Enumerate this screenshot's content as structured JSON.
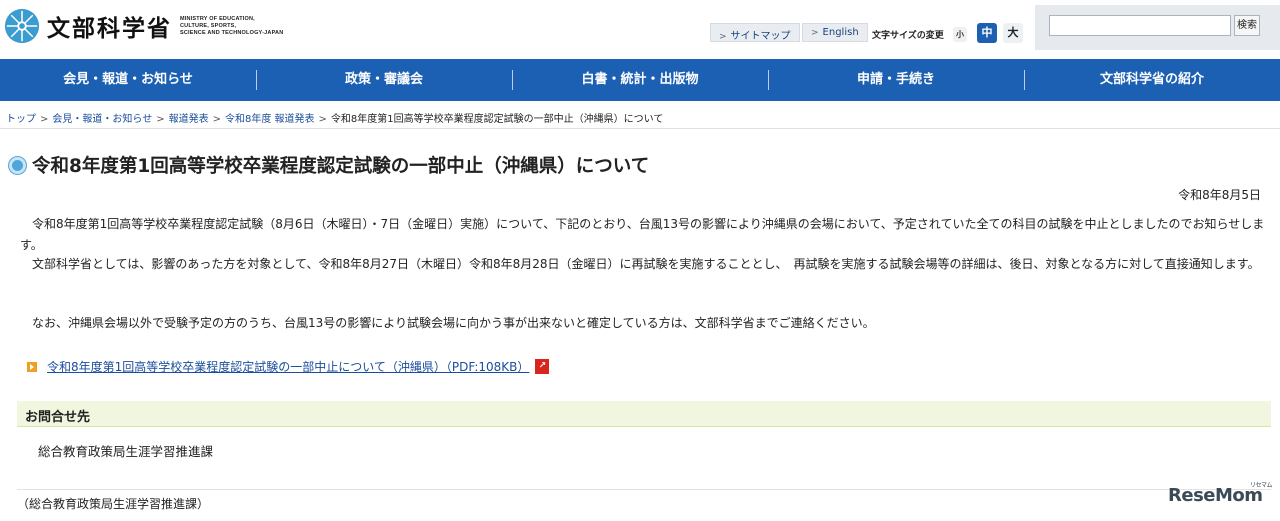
{
  "header": {
    "logo_text_jp": "文部科学省",
    "logo_text_en": [
      "MINISTRY OF EDUCATION,",
      "CULTURE, SPORTS,",
      "SCIENCE AND TECHNOLOGY-JAPAN"
    ],
    "sitemap_label": "サイトマップ",
    "english_label": "English",
    "font_size_label": "文字サイズの変更",
    "font_sizes": [
      "小",
      "中",
      "大"
    ],
    "search_placeholder": "",
    "search_button": "検索"
  },
  "gnav": {
    "items": [
      "会見・報道・お知らせ",
      "政策・審議会",
      "白書・統計・出版物",
      "申請・手続き",
      "文部科学省の紹介"
    ]
  },
  "breadcrumb": {
    "items": [
      "トップ",
      "会見・報道・お知らせ",
      "報道発表",
      "令和8年度 報道発表"
    ],
    "separator": ">",
    "current": "令和8年度第1回高等学校卒業程度認定試験の一部中止（沖縄県）について"
  },
  "main": {
    "title": "令和8年度第1回高等学校卒業程度認定試験の一部中止（沖縄県）について",
    "date": "令和8年8月5日",
    "paragraph1": "　令和8年度第1回高等学校卒業程度認定試験（8月6日（木曜日）・7日（金曜日）実施）について、下記のとおり、台風13号の影響により沖縄県の会場において、予定されていた全ての科目の試験を中止としましたのでお知らせします。",
    "paragraph2": "　文部科学省としては、影響のあった方を対象として、令和8年8月27日（木曜日）令和8年8月28日（金曜日）に再試験を実施することとし、　再試験を実施する試験会場等の詳細は、後日、対象となる方に対して直接通知します。",
    "paragraph3": "　なお、沖縄県会場以外で受験予定の方のうち、台風13号の影響により試験会場に向かう事が出来ないと確定している方は、文部科学省までご連絡ください。",
    "pdf_link": "令和8年度第1回高等学校卒業程度認定試験の一部中止について（沖縄県）（PDF:108KB）",
    "contact_heading": "お問合せ先",
    "contact_body": "総合教育政策局生涯学習推進課",
    "footer_note": "（総合教育政策局生涯学習推進課）"
  },
  "watermark": {
    "text": "ReseMom",
    "small": "リセマム"
  },
  "colors": {
    "nav_blue": "#1c60b3",
    "link_blue": "#1a4d9c",
    "contact_bg": "#f1f7de"
  }
}
